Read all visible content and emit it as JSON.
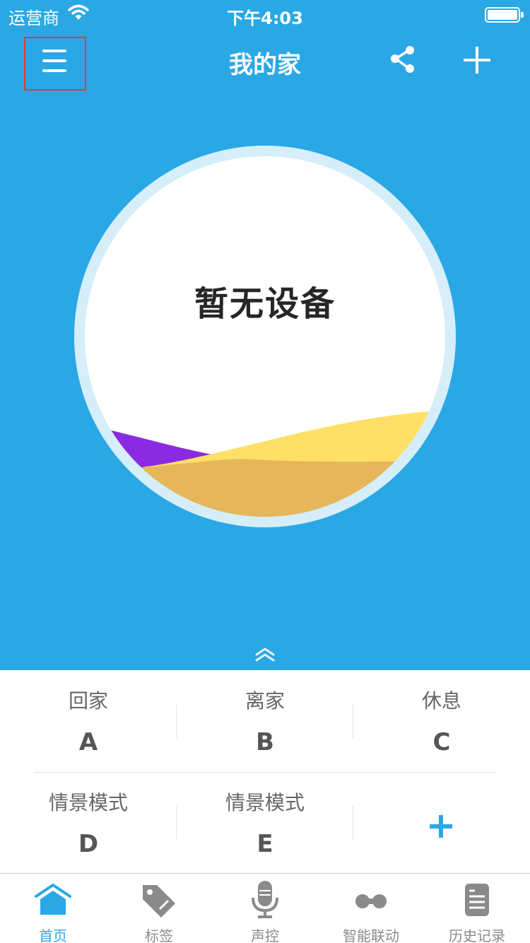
{
  "status_bar": {
    "carrier": "运营商",
    "time": "下午4:03"
  },
  "nav": {
    "title": "我的家"
  },
  "main": {
    "empty_message": "暂无设备"
  },
  "scenes": [
    {
      "name": "回家",
      "letter": "A"
    },
    {
      "name": "离家",
      "letter": "B"
    },
    {
      "name": "休息",
      "letter": "C"
    },
    {
      "name": "情景模式",
      "letter": "D"
    },
    {
      "name": "情景模式",
      "letter": "E"
    }
  ],
  "tabs": [
    {
      "label": "首页",
      "icon": "home-icon",
      "active": true
    },
    {
      "label": "标签",
      "icon": "tag-icon",
      "active": false
    },
    {
      "label": "声控",
      "icon": "microphone-icon",
      "active": false
    },
    {
      "label": "智能联动",
      "icon": "link-icon",
      "active": false
    },
    {
      "label": "历史记录",
      "icon": "history-icon",
      "active": false
    }
  ],
  "colors": {
    "primary": "#2aa8e5",
    "highlight_box": "#e53935",
    "wave_purple": "#8a2be2",
    "wave_yellow": "#ffe066",
    "wave_orange": "#e6b65a"
  }
}
